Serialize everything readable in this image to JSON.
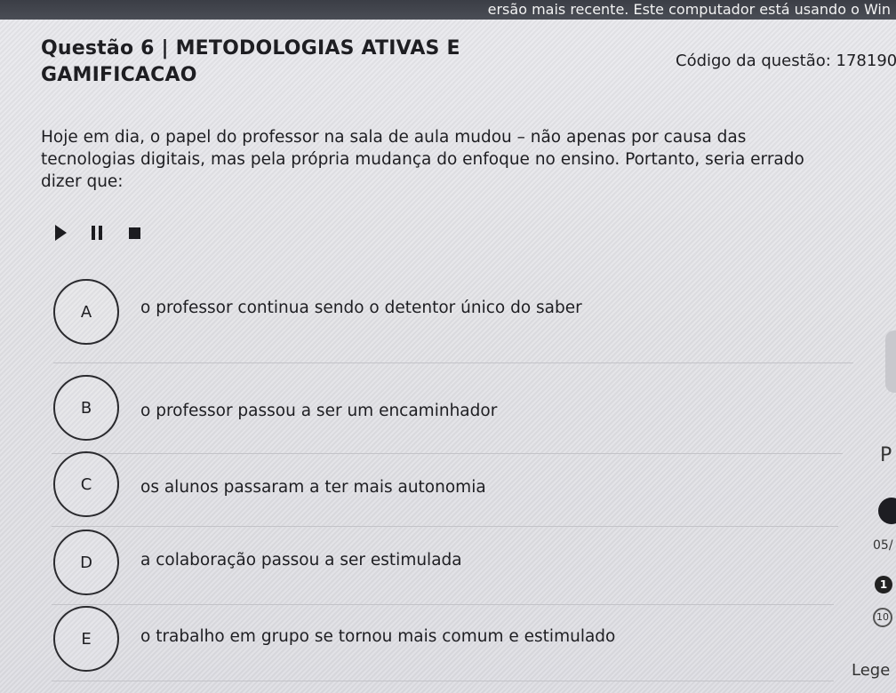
{
  "notification": "ersão mais recente. Este computador está usando o Win",
  "question": {
    "title": "Questão 6 | METODOLOGIAS ATIVAS E GAMIFICACAO",
    "code": "Código da questão: 178190",
    "statement": "Hoje em dia, o papel do professor na sala de aula mudou – não apenas por causa das tecnologias digitais, mas pela própria mudança do enfoque no ensino. Portanto, seria errado dizer que:"
  },
  "audio": {
    "play_icon": "play-icon",
    "pause_icon": "pause-icon",
    "stop_icon": "stop-icon"
  },
  "options": [
    {
      "letter": "A",
      "text": "o professor continua sendo o detentor único do saber"
    },
    {
      "letter": "B",
      "text": "o professor passou a ser um encaminhador"
    },
    {
      "letter": "C",
      "text": "os alunos passaram a ter mais autonomia"
    },
    {
      "letter": "D",
      "text": "a colaboração passou a ser estimulada"
    },
    {
      "letter": "E",
      "text": "o trabalho em grupo se tornou mais comum e estimulado"
    }
  ],
  "sidebar": {
    "letter": "P",
    "date_fragment": "05/",
    "badge": "1",
    "ring": "10",
    "legend_fragment": "Lege"
  }
}
